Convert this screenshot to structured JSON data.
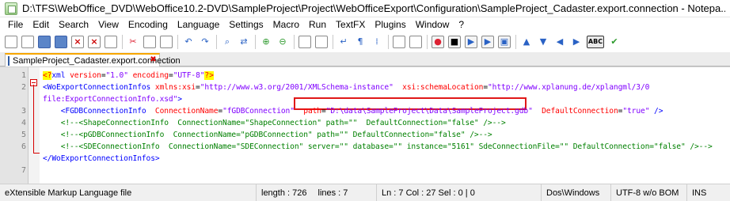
{
  "window": {
    "title": "D:\\TFS\\WebOffice_DVD\\WebOffice10.2-DVD\\SampleProject\\Project\\WebOfficeExport\\Configuration\\SampleProject_Cadaster.export.connection - Notepa..."
  },
  "menu": [
    "File",
    "Edit",
    "Search",
    "View",
    "Encoding",
    "Language",
    "Settings",
    "Macro",
    "Run",
    "TextFX",
    "Plugins",
    "Window",
    "?"
  ],
  "tab": {
    "label": "SampleProject_Cadaster.export.connection",
    "close": "✖"
  },
  "lines": [
    {
      "num": "1",
      "parts": [
        {
          "t": "<?",
          "c": "pi"
        },
        {
          "t": "xml",
          "c": "tag"
        },
        {
          "t": " ",
          "c": ""
        },
        {
          "t": "version",
          "c": "attr"
        },
        {
          "t": "=",
          "c": ""
        },
        {
          "t": "\"1.0\"",
          "c": "val"
        },
        {
          "t": " ",
          "c": ""
        },
        {
          "t": "encoding",
          "c": "attr"
        },
        {
          "t": "=",
          "c": ""
        },
        {
          "t": "\"UTF-8\"",
          "c": "val"
        },
        {
          "t": "?>",
          "c": "pi"
        }
      ]
    },
    {
      "num": "2",
      "parts": [
        {
          "t": "<",
          "c": "bracket"
        },
        {
          "t": "WoExportConnectionInfos",
          "c": "tag"
        },
        {
          "t": " ",
          "c": ""
        },
        {
          "t": "xmlns:xsi",
          "c": "attr"
        },
        {
          "t": "=",
          "c": ""
        },
        {
          "t": "\"http://www.w3.org/2001/XMLSchema-instance\"",
          "c": "val"
        },
        {
          "t": "  ",
          "c": ""
        },
        {
          "t": "xsi:schemaLocation",
          "c": "attr"
        },
        {
          "t": "=",
          "c": ""
        },
        {
          "t": "\"http://www.xplanung.de/xplangml/3/0",
          "c": "val"
        }
      ]
    },
    {
      "num": "",
      "parts": [
        {
          "t": "file:ExportConnectionInfo.xsd\"",
          "c": "val"
        },
        {
          "t": ">",
          "c": "bracket"
        }
      ]
    },
    {
      "num": "3",
      "parts": [
        {
          "t": "    <",
          "c": "bracket"
        },
        {
          "t": "FGDBConnectionInfo",
          "c": "tag"
        },
        {
          "t": "  ",
          "c": ""
        },
        {
          "t": "ConnectionName",
          "c": "attr"
        },
        {
          "t": "=",
          "c": ""
        },
        {
          "t": "\"fGDBConnection\"",
          "c": "val"
        },
        {
          "t": "  ",
          "c": ""
        },
        {
          "t": "path",
          "c": "attr"
        },
        {
          "t": "=",
          "c": ""
        },
        {
          "t": "\"D:\\data\\SampleProject\\Data\\SampleProject.gdb\"",
          "c": "val"
        },
        {
          "t": "  ",
          "c": ""
        },
        {
          "t": "DefaultConnection",
          "c": "attr"
        },
        {
          "t": "=",
          "c": ""
        },
        {
          "t": "\"true\"",
          "c": "val"
        },
        {
          "t": " />",
          "c": "bracket"
        }
      ]
    },
    {
      "num": "4",
      "parts": [
        {
          "t": "    <!--<ShapeConnectionInfo  ConnectionName=\"ShapeConnection\" path=\"\"  DefaultConnection=\"false\" />-->",
          "c": "cmt"
        }
      ]
    },
    {
      "num": "5",
      "parts": [
        {
          "t": "    <!--<pGDBConnectionInfo  ConnectionName=\"pGDBConnection\" path=\"\" DefaultConnection=\"false\" />-->",
          "c": "cmt"
        }
      ]
    },
    {
      "num": "6",
      "parts": [
        {
          "t": "    <!--<SDEConnectionInfo  ConnectionName=\"SDEConnection\" server=\"\" database=\"\" instance=\"5161\" SdeConnectionFile=\"\" DefaultConnection=\"false\" />-->",
          "c": "cmt"
        }
      ]
    },
    {
      "num": "",
      "parts": [
        {
          "t": "</",
          "c": "bracket"
        },
        {
          "t": "WoExportConnectionInfos",
          "c": "tag"
        },
        {
          "t": ">",
          "c": "bracket"
        }
      ]
    },
    {
      "num": "7",
      "parts": []
    }
  ],
  "status": {
    "type": "eXtensible Markup Language file",
    "length": "length : 726",
    "lines": "lines : 7",
    "position": "Ln : 7    Col : 27    Sel : 0 | 0",
    "eol": "Dos\\Windows",
    "encoding": "UTF-8 w/o BOM",
    "mode": "INS"
  }
}
